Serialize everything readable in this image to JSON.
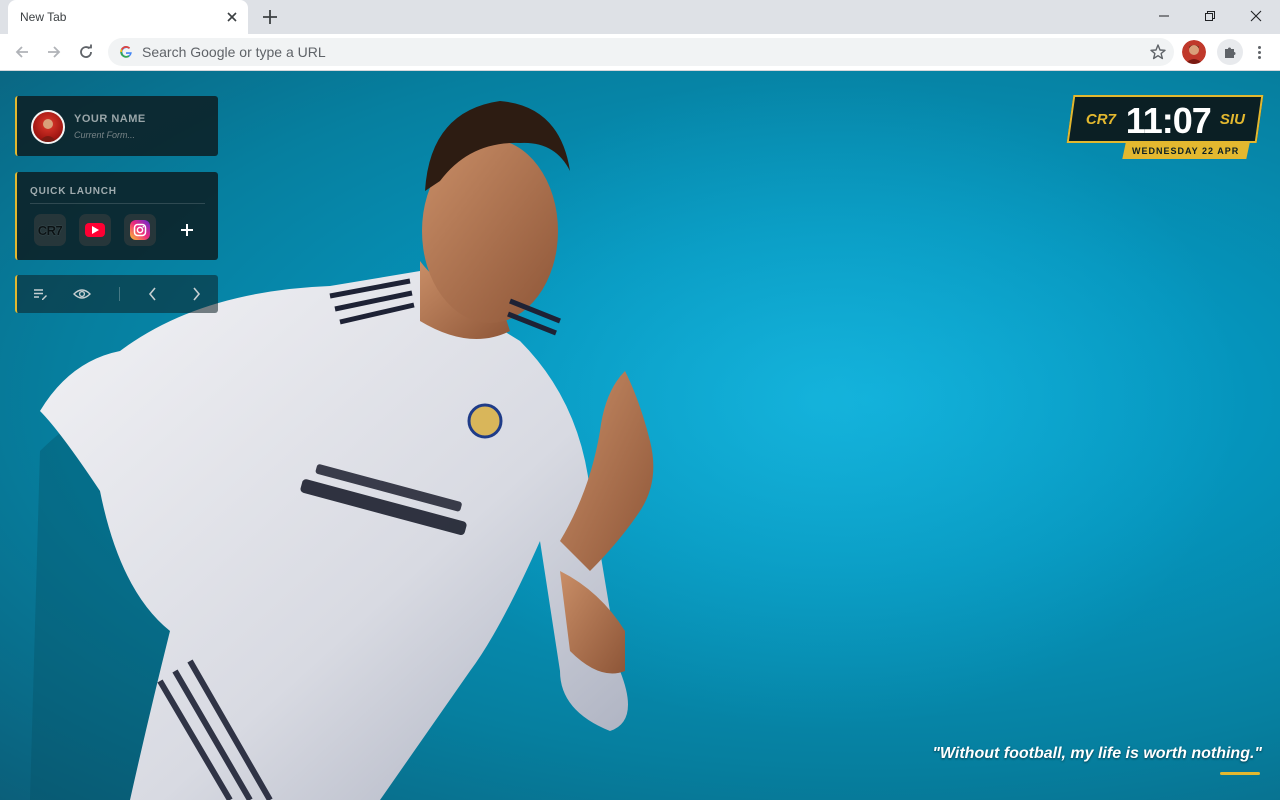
{
  "browser": {
    "tab_title": "New Tab",
    "omnibox_placeholder": "Search Google or type a URL"
  },
  "icons": {
    "tab_close": "close-icon",
    "new_tab": "plus-icon",
    "back": "arrow-left-icon",
    "forward": "arrow-right-icon",
    "reload": "reload-icon",
    "bookmark": "star-icon",
    "extensions": "puzzle-icon",
    "menu": "kebab-menu-icon"
  },
  "profile": {
    "name": "YOUR NAME",
    "form_placeholder": "Current Form..."
  },
  "quick_launch": {
    "title": "QUICK LAUNCH",
    "items": [
      {
        "label": "CR7",
        "icon": "cr7-logo-icon"
      },
      {
        "label": "",
        "icon": "youtube-icon"
      },
      {
        "label": "",
        "icon": "instagram-icon"
      }
    ],
    "add_icon": "plus-icon"
  },
  "tools": {
    "icons": [
      "edit-list-icon",
      "eye-icon",
      "chevron-left-icon",
      "chevron-right-icon"
    ]
  },
  "clock": {
    "left_tag": "CR7",
    "time": "11:07",
    "right_tag": "SIU",
    "date": "WEDNESDAY 22 APR"
  },
  "quote": "\"Without football, my life is worth nothing.\"",
  "colors": {
    "accent": "#e3b82f",
    "background": "#0597c0",
    "panel": "#0c2026"
  }
}
